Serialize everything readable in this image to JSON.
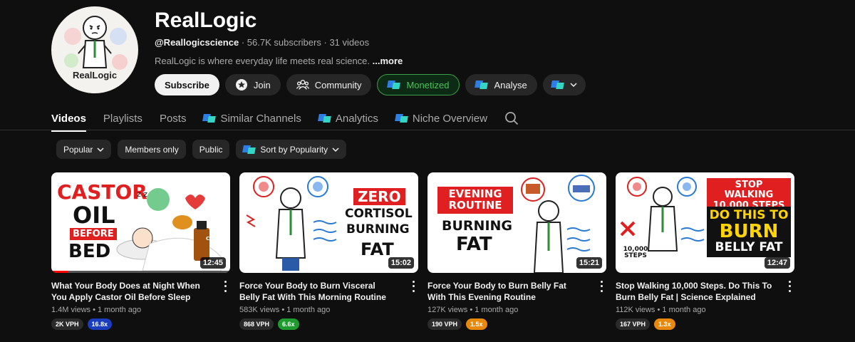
{
  "channel": {
    "title": "RealLogic",
    "avatar_label": "RealLogic",
    "handle": "@Reallogicscience",
    "subscribers": "56.7K subscribers",
    "videos_count": "31 videos",
    "separator": "·",
    "description": "RealLogic is where everyday life meets real science.",
    "more_label": "...more"
  },
  "actions": {
    "subscribe": "Subscribe",
    "join": "Join",
    "community": "Community",
    "monetized": "Monetized",
    "analyse": "Analyse"
  },
  "tabs": [
    {
      "label": "Videos"
    },
    {
      "label": "Playlists"
    },
    {
      "label": "Posts"
    },
    {
      "label": "Similar Channels"
    },
    {
      "label": "Analytics"
    },
    {
      "label": "Niche Overview"
    }
  ],
  "filters": {
    "popular": "Popular",
    "members_only": "Members only",
    "public": "Public",
    "sort": "Sort by Popularity"
  },
  "videos": [
    {
      "title": "What Your Body Does at Night When You Apply Castor Oil Before Sleep",
      "views": "1.4M views",
      "age": "1 month ago",
      "duration": "12:45",
      "vph": "2K VPH",
      "ratio": "16.8x",
      "ratio_color": "#1a3dbd",
      "watched_fraction": 0.09,
      "thumb_lines": [
        "CASTOR",
        "OIL",
        "BEFORE",
        "BED"
      ],
      "bottle_label": "Castor Oil"
    },
    {
      "title": "Force Your Body to Burn Visceral Belly Fat With This Morning Routine",
      "views": "583K views",
      "age": "1 month ago",
      "duration": "15:02",
      "vph": "868 VPH",
      "ratio": "6.6x",
      "ratio_color": "#1e9b2f",
      "thumb_lines": [
        "ZERO",
        "CORTISOL",
        "BURNING",
        "FAT"
      ]
    },
    {
      "title": "Force Your Body to Burn Belly Fat With This Evening Routine",
      "views": "127K views",
      "age": "1 month ago",
      "duration": "15:21",
      "vph": "190 VPH",
      "ratio": "1.5x",
      "ratio_color": "#e8890c",
      "thumb_lines": [
        "EVENING",
        "ROUTINE",
        "BURNING",
        "FAT"
      ]
    },
    {
      "title": "Stop Walking 10,000 Steps. Do This To Burn Belly Fat | Science Explained",
      "views": "112K views",
      "age": "1 month ago",
      "duration": "12:47",
      "vph": "167 VPH",
      "ratio": "1.3x",
      "ratio_color": "#e8890c",
      "thumb_lines": [
        "STOP WALKING",
        "10,000 STEPS",
        "DO THIS TO",
        "BURN",
        "BELLY FAT"
      ],
      "steps_label": "10,000",
      "steps_label2": "STEPS"
    }
  ]
}
